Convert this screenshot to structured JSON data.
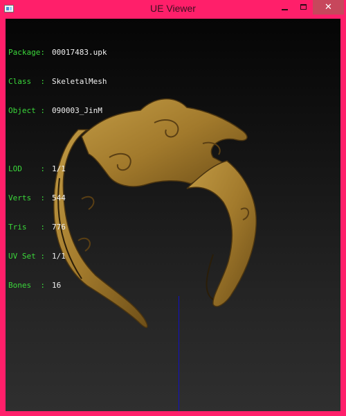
{
  "window": {
    "title": "UE Viewer",
    "controls": {
      "minimize": "minimize",
      "maximize": "maximize",
      "close": "✕"
    }
  },
  "info": {
    "rows_top": [
      {
        "label": "Package:",
        "value": "00017483.upk"
      },
      {
        "label": "Class  :",
        "value": "SkeletalMesh"
      },
      {
        "label": "Object :",
        "value": "090003_JinM"
      }
    ],
    "rows_bottom": [
      {
        "label": "LOD    :",
        "value": "1/1"
      },
      {
        "label": "Verts  :",
        "value": "544"
      },
      {
        "label": "Tris   :",
        "value": "776"
      },
      {
        "label": "UV Set :",
        "value": "1/1"
      },
      {
        "label": "Bones  :",
        "value": "16"
      }
    ]
  },
  "colors": {
    "frame": "#ff1f6a",
    "label": "#3bd93b",
    "value": "#f0f0f0",
    "mesh": "#a7802f",
    "axis": "#1010c8"
  }
}
